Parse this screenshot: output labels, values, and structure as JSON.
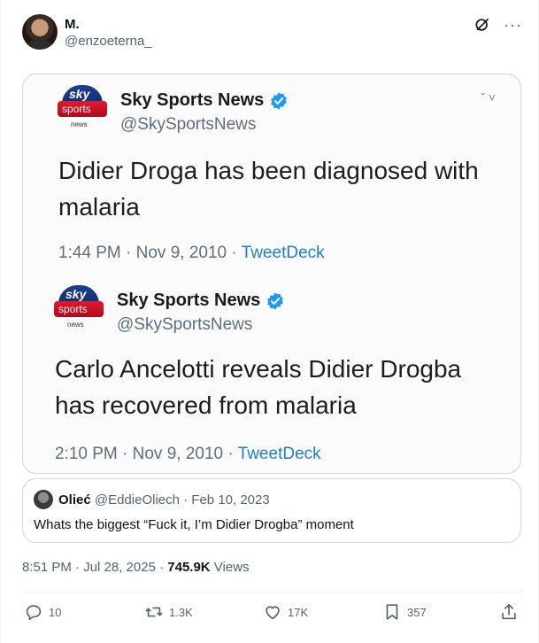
{
  "author": {
    "name": "M.",
    "handle": "@enzoeterna_"
  },
  "screenshot": {
    "tweets": [
      {
        "logo": {
          "top": "sky",
          "middle": "sports",
          "bottom": "news"
        },
        "name": "Sky Sports News",
        "handle": "@SkySportsNews",
        "text": "Didier Droga has been diagnosed with malaria",
        "time": "1:44 PM · Nov 9, 2010 · ",
        "source": "TweetDeck"
      },
      {
        "logo": {
          "top": "sky",
          "middle": "sports",
          "bottom": "news"
        },
        "name": "Sky Sports News",
        "handle": "@SkySportsNews",
        "text": "Carlo Ancelotti reveals Didier Drogba has recovered from malaria",
        "time": "2:10 PM · Nov 9, 2010 · ",
        "source": "TweetDeck"
      }
    ]
  },
  "quote": {
    "name": "Olieć",
    "handle": "@EddieOliech",
    "date": " · Feb 10, 2023",
    "text": "Whats the biggest “Fuck it, I’m Didier Drogba” moment"
  },
  "meta": {
    "time": "8:51 PM · Jul 28, 2025 · ",
    "views_count": "745.9K",
    "views_label": " Views"
  },
  "actions": {
    "replies": "10",
    "reposts": "1.3K",
    "likes": "17K",
    "bookmarks": "357"
  },
  "colors": {
    "accent": "#1d9bf0",
    "muted": "#536471",
    "border": "#cfd9de",
    "sky_blue": "#0b2462",
    "sky_red": "#e01b2e"
  },
  "icons": [
    "grok-icon",
    "more-icon",
    "verified-icon",
    "reply-icon",
    "repost-icon",
    "like-icon",
    "bookmark-icon",
    "share-icon"
  ]
}
